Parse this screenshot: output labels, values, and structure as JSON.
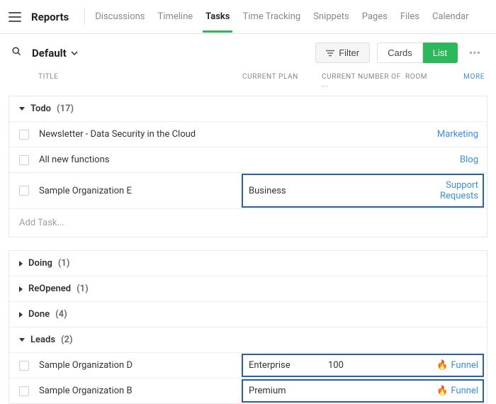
{
  "header": {
    "page_title": "Reports",
    "tabs": [
      "Discussions",
      "Timeline",
      "Tasks",
      "Time Tracking",
      "Snippets",
      "Pages",
      "Files",
      "Calendar"
    ],
    "active_tab": "Tasks"
  },
  "toolbar": {
    "view_name": "Default",
    "filter_label": "Filter",
    "cards_label": "Cards",
    "list_label": "List",
    "active_view": "List"
  },
  "columns": {
    "title": "TITLE",
    "plan": "CURRENT PLAN",
    "number": "CURRENT NUMBER OF ...",
    "room": "ROOM",
    "more": "MORE"
  },
  "groups": {
    "todo": {
      "label": "Todo",
      "count": 17,
      "expanded": true
    },
    "doing": {
      "label": "Doing",
      "count": 1,
      "expanded": false
    },
    "reopened": {
      "label": "ReOpened",
      "count": 1,
      "expanded": false
    },
    "done": {
      "label": "Done",
      "count": 4,
      "expanded": false
    },
    "leads": {
      "label": "Leads",
      "count": 2,
      "expanded": true
    }
  },
  "todo_rows": [
    {
      "title": "Newsletter - Data Security in the Cloud",
      "plan": "",
      "num": "",
      "room": "Marketing",
      "hl": false
    },
    {
      "title": "All new functions",
      "plan": "",
      "num": "",
      "room": "Blog",
      "hl": false
    },
    {
      "title": "Sample Organization E",
      "plan": "Business",
      "num": "",
      "room": "Support Requests",
      "hl": true
    }
  ],
  "leads_rows": [
    {
      "title": "Sample Organization D",
      "plan": "Enterprise",
      "num": "100",
      "room": "Funnel",
      "hl": true
    },
    {
      "title": "Sample Organization B",
      "plan": "Premium",
      "num": "",
      "room": "Funnel",
      "hl": true
    }
  ],
  "add_task_label": "Add Task...",
  "icons": {
    "fire": "🔥"
  }
}
